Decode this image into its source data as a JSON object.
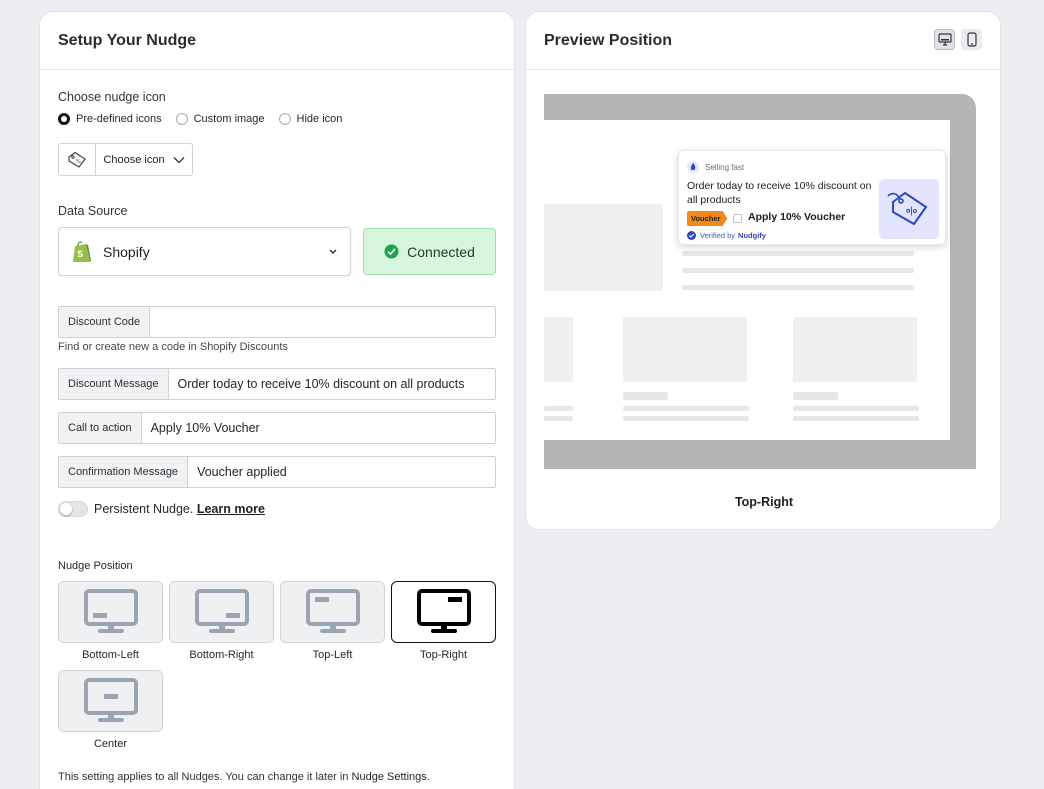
{
  "setup": {
    "title": "Setup Your Nudge",
    "icon_section": {
      "label": "Choose nudge icon",
      "options": [
        "Pre-defined icons",
        "Custom image",
        "Hide icon"
      ],
      "selected": "Pre-defined icons",
      "choose_label": "Choose icon"
    },
    "data_source": {
      "label": "Data Source",
      "value": "Shopify",
      "status": "Connected"
    },
    "fields": {
      "discount_code": {
        "label": "Discount Code",
        "value": ""
      },
      "discount_code_help": "Find or create new a code in Shopify Discounts",
      "discount_message": {
        "label": "Discount Message",
        "value": "Order today to receive 10% discount on all products"
      },
      "cta": {
        "label": "Call to action",
        "value": "Apply 10% Voucher"
      },
      "confirmation": {
        "label": "Confirmation Message",
        "value": "Voucher applied"
      }
    },
    "persistent": {
      "text": "Persistent Nudge.",
      "link": "Learn more",
      "enabled": false
    },
    "position": {
      "label": "Nudge Position",
      "options": [
        "Bottom-Left",
        "Bottom-Right",
        "Top-Left",
        "Top-Right",
        "Center"
      ],
      "selected": "Top-Right"
    },
    "footnote": {
      "text": "This setting applies to all Nudges. You can change it later in",
      "link": "Nudge Settings."
    }
  },
  "preview": {
    "title": "Preview Position",
    "view": "desktop",
    "nudge": {
      "badge": "Selling fast",
      "message": "Order today to receive 10% discount on all products",
      "voucher_tag": "Voucher",
      "cta": "Apply 10% Voucher",
      "verified_prefix": "Verified by",
      "verified_brand": "Nudgify"
    },
    "position_label": "Top-Right"
  },
  "colors": {
    "connected_bg": "#d8f5de",
    "shopify_green": "#95bf47",
    "voucher_orange": "#f08a1c",
    "brand_blue": "#3047c0",
    "icon_bg": "#e2e5fb",
    "monitor_idle": "#9aa5b4"
  }
}
